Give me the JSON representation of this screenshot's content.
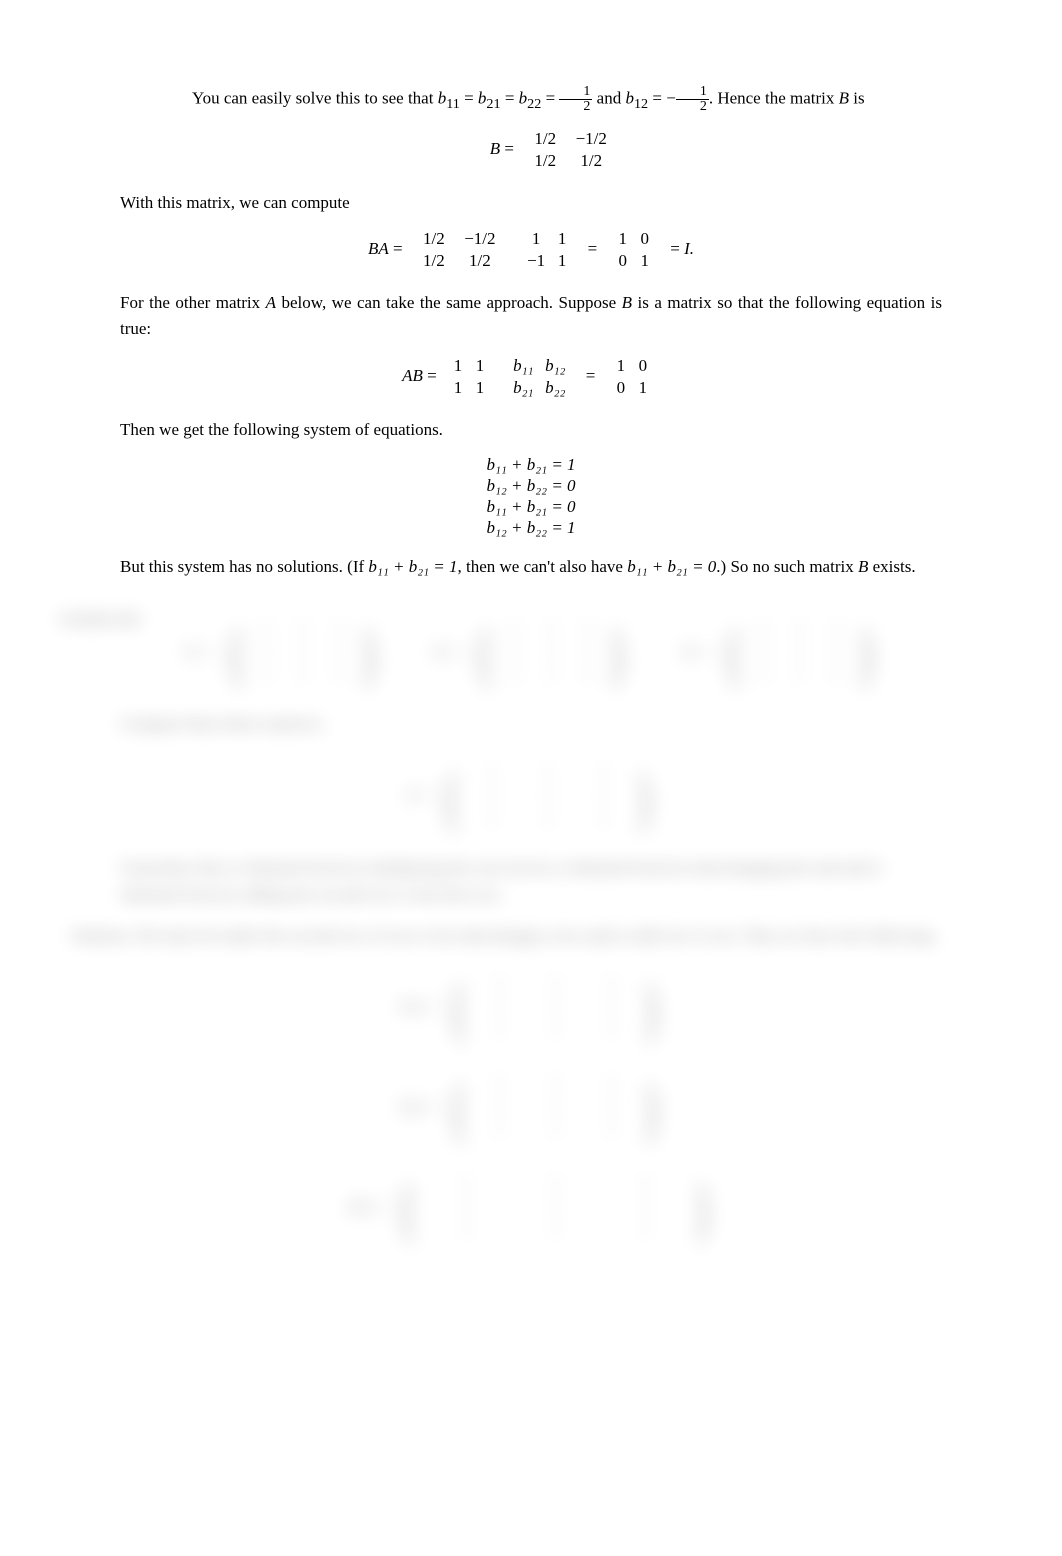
{
  "para1_pre": "You can easily solve this to see that ",
  "para1_math1": "b",
  "para1_sub11": "11",
  "para1_eq": " = ",
  "para1_math2": "b",
  "para1_sub21": "21",
  "para1_math3": "b",
  "para1_sub22": "22",
  "para1_frac1_num": "1",
  "para1_frac1_den": "2",
  "para1_and": " and ",
  "para1_math4": "b",
  "para1_sub12": "12",
  "para1_neg": " = −",
  "para1_frac2_num": "1",
  "para1_frac2_den": "2",
  "para1_post": ". Hence the matrix ",
  "para1_B": "B",
  "para1_is": " is",
  "eq1_lhs": "B",
  "eq1_m11": "1/2",
  "eq1_m12": "−1/2",
  "eq1_m21": "1/2",
  "eq1_m22": "1/2",
  "para2": "With this matrix, we can compute",
  "eq2_lhs": "BA",
  "eq2_a11": "1/2",
  "eq2_a12": "−1/2",
  "eq2_a21": "1/2",
  "eq2_a22": "1/2",
  "eq2_b11": "1",
  "eq2_b12": "1",
  "eq2_b21": "−1",
  "eq2_b22": "1",
  "eq2_c11": "1",
  "eq2_c12": "0",
  "eq2_c21": "0",
  "eq2_c22": "1",
  "eq2_rhs": "I.",
  "para3_a": "For the other matrix ",
  "para3_A": "A",
  "para3_b": " below, we can take the same approach. Suppose ",
  "para3_B": "B",
  "para3_c": " is a matrix so that the following equation is true:",
  "eq3_lhs": "AB",
  "eq3_a11": "1",
  "eq3_a12": "1",
  "eq3_a21": "1",
  "eq3_a22": "1",
  "eq3_b11": "b₁₁",
  "eq3_b12": "b₁₂",
  "eq3_b21": "b₂₁",
  "eq3_b22": "b₂₂",
  "eq3_c11": "1",
  "eq3_c12": "0",
  "eq3_c21": "0",
  "eq3_c22": "1",
  "para4": "Then we get the following system of equations.",
  "sys1": "b₁₁ + b₂₁ = 1",
  "sys2": "b₁₂ + b₂₂ = 0",
  "sys3": "b₁₁ + b₂₁ = 0",
  "sys4": "b₁₂ + b₂₂ = 1",
  "para5_a": "But this system has no solutions. (If ",
  "para5_m1": "b₁₁ + b₂₁ = 1",
  "para5_b": ", then we can't also have ",
  "para5_m2": "b₁₁ + b₂₁ = 0",
  "para5_c": ".) So no such matrix ",
  "para5_B": "B",
  "para5_d": " exists.",
  "blur_exercise_label": "EXERCISE",
  "blur_eq_prefix1": "A₁ =",
  "blur_eq_prefix2": "A₂ =",
  "blur_eq_prefix3": "A₃ =",
  "blur_cell": "•",
  "blur_para_a": "Compute these three matrices.",
  "blur_eq_A": "A =",
  "blur_para_b": "Generalize this to obtained from by multiplying the rows by by is obtained from by interchanging the and and is obtained from by adding the second row to the first row.",
  "blur_para_c": "Solution. We must do under the second row of row to by interchanges rows and to add row to row. Thus we have the following.",
  "blur_eq_fin1": "A₁a =",
  "blur_eq_fin2": "A₂a =",
  "blur_eq_fin3": "A₃a ="
}
